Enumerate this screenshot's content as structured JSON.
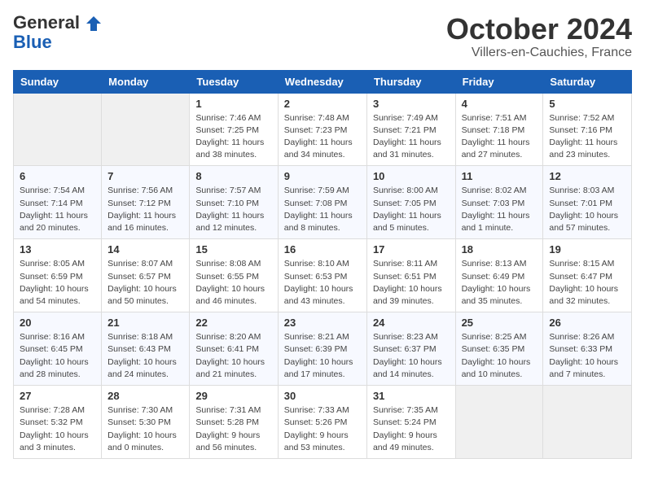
{
  "header": {
    "logo_general": "General",
    "logo_blue": "Blue",
    "month_title": "October 2024",
    "location": "Villers-en-Cauchies, France"
  },
  "calendar": {
    "headers": [
      "Sunday",
      "Monday",
      "Tuesday",
      "Wednesday",
      "Thursday",
      "Friday",
      "Saturday"
    ],
    "weeks": [
      [
        {
          "day": "",
          "info": ""
        },
        {
          "day": "",
          "info": ""
        },
        {
          "day": "1",
          "info": "Sunrise: 7:46 AM\nSunset: 7:25 PM\nDaylight: 11 hours\nand 38 minutes."
        },
        {
          "day": "2",
          "info": "Sunrise: 7:48 AM\nSunset: 7:23 PM\nDaylight: 11 hours\nand 34 minutes."
        },
        {
          "day": "3",
          "info": "Sunrise: 7:49 AM\nSunset: 7:21 PM\nDaylight: 11 hours\nand 31 minutes."
        },
        {
          "day": "4",
          "info": "Sunrise: 7:51 AM\nSunset: 7:18 PM\nDaylight: 11 hours\nand 27 minutes."
        },
        {
          "day": "5",
          "info": "Sunrise: 7:52 AM\nSunset: 7:16 PM\nDaylight: 11 hours\nand 23 minutes."
        }
      ],
      [
        {
          "day": "6",
          "info": "Sunrise: 7:54 AM\nSunset: 7:14 PM\nDaylight: 11 hours\nand 20 minutes."
        },
        {
          "day": "7",
          "info": "Sunrise: 7:56 AM\nSunset: 7:12 PM\nDaylight: 11 hours\nand 16 minutes."
        },
        {
          "day": "8",
          "info": "Sunrise: 7:57 AM\nSunset: 7:10 PM\nDaylight: 11 hours\nand 12 minutes."
        },
        {
          "day": "9",
          "info": "Sunrise: 7:59 AM\nSunset: 7:08 PM\nDaylight: 11 hours\nand 8 minutes."
        },
        {
          "day": "10",
          "info": "Sunrise: 8:00 AM\nSunset: 7:05 PM\nDaylight: 11 hours\nand 5 minutes."
        },
        {
          "day": "11",
          "info": "Sunrise: 8:02 AM\nSunset: 7:03 PM\nDaylight: 11 hours\nand 1 minute."
        },
        {
          "day": "12",
          "info": "Sunrise: 8:03 AM\nSunset: 7:01 PM\nDaylight: 10 hours\nand 57 minutes."
        }
      ],
      [
        {
          "day": "13",
          "info": "Sunrise: 8:05 AM\nSunset: 6:59 PM\nDaylight: 10 hours\nand 54 minutes."
        },
        {
          "day": "14",
          "info": "Sunrise: 8:07 AM\nSunset: 6:57 PM\nDaylight: 10 hours\nand 50 minutes."
        },
        {
          "day": "15",
          "info": "Sunrise: 8:08 AM\nSunset: 6:55 PM\nDaylight: 10 hours\nand 46 minutes."
        },
        {
          "day": "16",
          "info": "Sunrise: 8:10 AM\nSunset: 6:53 PM\nDaylight: 10 hours\nand 43 minutes."
        },
        {
          "day": "17",
          "info": "Sunrise: 8:11 AM\nSunset: 6:51 PM\nDaylight: 10 hours\nand 39 minutes."
        },
        {
          "day": "18",
          "info": "Sunrise: 8:13 AM\nSunset: 6:49 PM\nDaylight: 10 hours\nand 35 minutes."
        },
        {
          "day": "19",
          "info": "Sunrise: 8:15 AM\nSunset: 6:47 PM\nDaylight: 10 hours\nand 32 minutes."
        }
      ],
      [
        {
          "day": "20",
          "info": "Sunrise: 8:16 AM\nSunset: 6:45 PM\nDaylight: 10 hours\nand 28 minutes."
        },
        {
          "day": "21",
          "info": "Sunrise: 8:18 AM\nSunset: 6:43 PM\nDaylight: 10 hours\nand 24 minutes."
        },
        {
          "day": "22",
          "info": "Sunrise: 8:20 AM\nSunset: 6:41 PM\nDaylight: 10 hours\nand 21 minutes."
        },
        {
          "day": "23",
          "info": "Sunrise: 8:21 AM\nSunset: 6:39 PM\nDaylight: 10 hours\nand 17 minutes."
        },
        {
          "day": "24",
          "info": "Sunrise: 8:23 AM\nSunset: 6:37 PM\nDaylight: 10 hours\nand 14 minutes."
        },
        {
          "day": "25",
          "info": "Sunrise: 8:25 AM\nSunset: 6:35 PM\nDaylight: 10 hours\nand 10 minutes."
        },
        {
          "day": "26",
          "info": "Sunrise: 8:26 AM\nSunset: 6:33 PM\nDaylight: 10 hours\nand 7 minutes."
        }
      ],
      [
        {
          "day": "27",
          "info": "Sunrise: 7:28 AM\nSunset: 5:32 PM\nDaylight: 10 hours\nand 3 minutes."
        },
        {
          "day": "28",
          "info": "Sunrise: 7:30 AM\nSunset: 5:30 PM\nDaylight: 10 hours\nand 0 minutes."
        },
        {
          "day": "29",
          "info": "Sunrise: 7:31 AM\nSunset: 5:28 PM\nDaylight: 9 hours\nand 56 minutes."
        },
        {
          "day": "30",
          "info": "Sunrise: 7:33 AM\nSunset: 5:26 PM\nDaylight: 9 hours\nand 53 minutes."
        },
        {
          "day": "31",
          "info": "Sunrise: 7:35 AM\nSunset: 5:24 PM\nDaylight: 9 hours\nand 49 minutes."
        },
        {
          "day": "",
          "info": ""
        },
        {
          "day": "",
          "info": ""
        }
      ]
    ]
  }
}
